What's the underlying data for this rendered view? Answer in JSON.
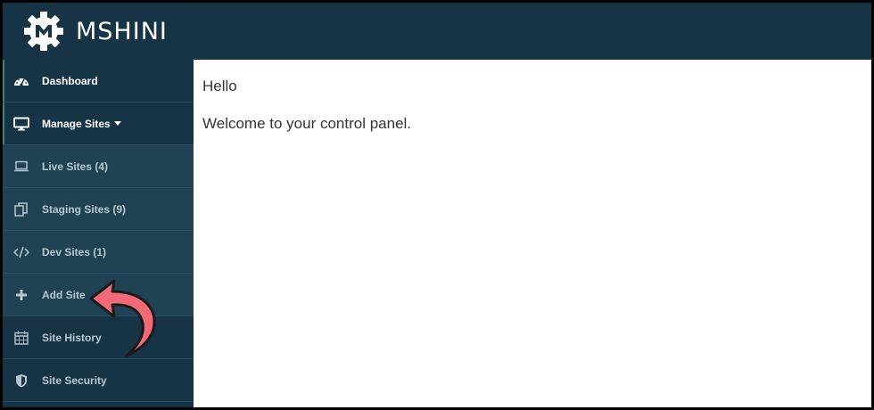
{
  "app": {
    "brand": "MSHINI"
  },
  "sidebar": {
    "items": [
      {
        "label": "Dashboard",
        "icon": "dashboard-gauge-icon"
      },
      {
        "label": "Manage Sites",
        "icon": "monitor-icon"
      },
      {
        "label": "Live Sites (4)",
        "icon": "laptop-icon"
      },
      {
        "label": "Staging Sites (9)",
        "icon": "copy-files-icon"
      },
      {
        "label": "Dev Sites (1)",
        "icon": "code-icon"
      },
      {
        "label": "Add Site",
        "icon": "plus-icon"
      },
      {
        "label": "Site History",
        "icon": "calendar-icon"
      },
      {
        "label": "Site Security",
        "icon": "shield-icon"
      }
    ]
  },
  "main": {
    "greeting": "Hello",
    "welcome": "Welcome to your control panel."
  },
  "colors": {
    "topbar": "#163446",
    "sidebar": "#163446",
    "submenu": "#1f4354",
    "annotation_arrow": "#f26a78"
  }
}
